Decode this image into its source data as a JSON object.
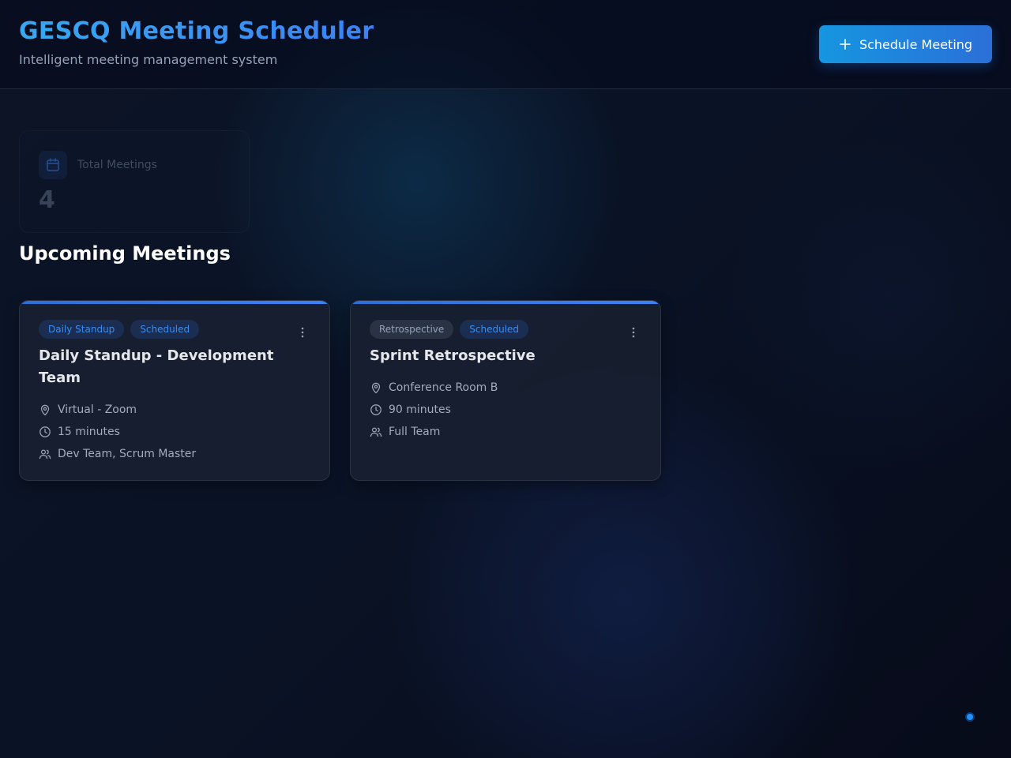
{
  "header": {
    "title": "GESCQ Meeting Scheduler",
    "subtitle": "Intelligent meeting management system",
    "schedule_button_label": "Schedule Meeting"
  },
  "stats": {
    "total_meetings_label": "Total Meetings",
    "total_meetings_value": "4"
  },
  "section": {
    "title": "Upcoming Meetings"
  },
  "meetings": [
    {
      "type_tag": "Daily Standup",
      "status_tag": "Scheduled",
      "title": "Daily Standup - Development Team",
      "location": "Virtual - Zoom",
      "duration": "15 minutes",
      "attendees": "Dev Team, Scrum Master"
    },
    {
      "type_tag": "Retrospective",
      "status_tag": "Scheduled",
      "title": "Sprint Retrospective",
      "location": "Conference Room B",
      "duration": "90 minutes",
      "attendees": "Full Team"
    }
  ],
  "icons": {
    "plus": "plus-icon",
    "calendar": "calendar-icon",
    "location": "map-pin-icon",
    "duration": "clock-icon",
    "attendees": "users-icon",
    "menu": "more-vertical-icon"
  },
  "colors": {
    "accent": "#3b82f6",
    "accent_light": "#38a8f0",
    "background": "#0b1222",
    "card": "#181f30"
  }
}
